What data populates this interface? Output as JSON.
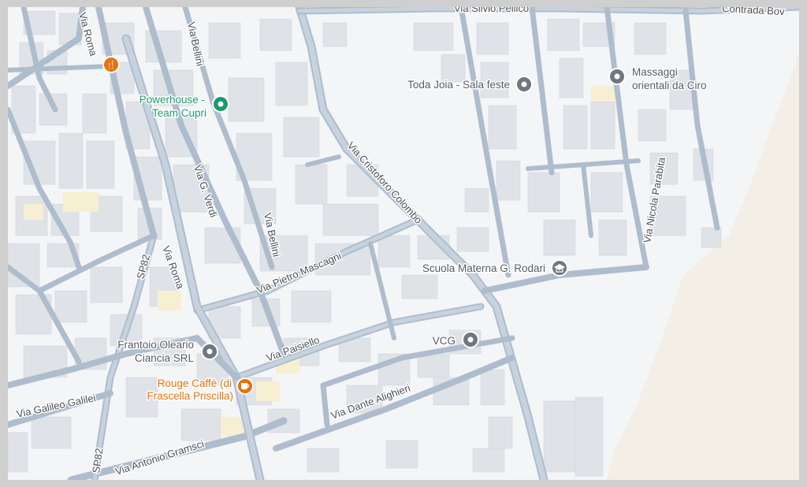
{
  "colors": {
    "land": "#f4f5f7",
    "building": "#dfe2e7",
    "road": "#aebdcd",
    "beach": "#f3efe6",
    "highlight": "#f7efd2",
    "poi_generic": "#6f7780",
    "poi_green": "#1e9a6a",
    "poi_orange": "#e8710a"
  },
  "streets": {
    "via_silvio_pellico": "Via Silvio Pellico",
    "contrada_bov": "Contrada Bov",
    "via_roma_top": "Via Roma",
    "via_bellini_top": "Via Bellini",
    "via_bellini_mid": "Via Bellini",
    "via_g_verdi": "Via G. Verdi",
    "via_cristoforo_colombo": "Via Cristoforo Colombo",
    "via_nicola_parabita": "Via Nicola Parabita",
    "via_pietro_mascagni": "Via Pietro Mascagni",
    "sp82_upper": "SP82",
    "sp82_lower": "SP82",
    "via_roma_mid": "Via Roma",
    "via_paisiello": "Via Paisiello",
    "via_dante_alighieri": "Via Dante Alighieri",
    "via_galileo_galilei": "Via Galileo Galilei",
    "via_antonio_gramsci": "Via Antonio Gramsci"
  },
  "pois": {
    "powerhouse": {
      "line1": "Powerhouse -",
      "line2": "Team Cupri",
      "icon": "fitness-pin-icon"
    },
    "toda_joia": {
      "line1": "Toda Joia - Sala feste",
      "icon": "location-pin-icon"
    },
    "massaggi": {
      "line1": "Massaggi",
      "line2": "orientali da Ciro",
      "icon": "location-pin-icon"
    },
    "scuola": {
      "line1": "Scuola Materna G. Rodari",
      "icon": "school-pin-icon"
    },
    "vcg": {
      "line1": "VCG",
      "icon": "location-pin-icon"
    },
    "frantoio": {
      "line1": "Frantoio Oleario",
      "line2": "Ciancia SRL",
      "icon": "location-pin-icon"
    },
    "rouge": {
      "line1": "Rouge Caffè (di",
      "line2": "Frascella Priscilla)",
      "icon": "cafe-pin-icon"
    },
    "restaurant": {
      "icon": "restaurant-pin-icon"
    }
  }
}
